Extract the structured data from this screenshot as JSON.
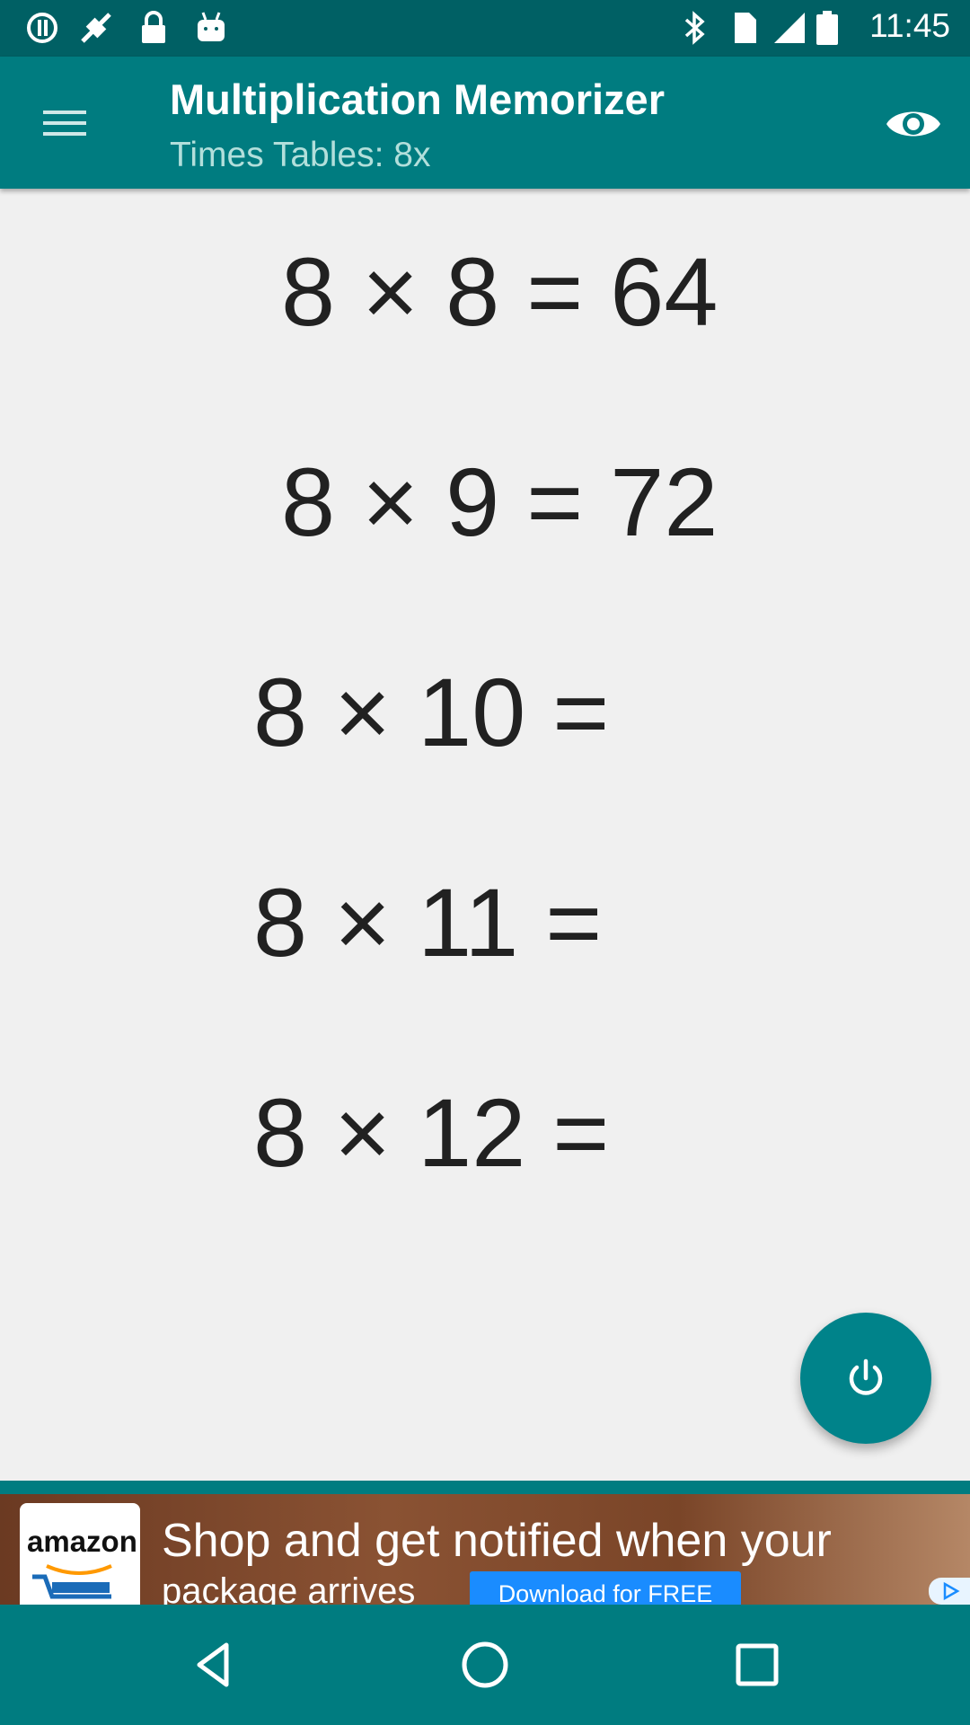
{
  "status_bar": {
    "time": "11:45",
    "icons": [
      "sync-icon",
      "no-signal-icon",
      "lock-icon",
      "android-icon",
      "bluetooth-icon",
      "sim-icon",
      "signal-icon",
      "battery-icon"
    ]
  },
  "app_bar": {
    "title": "Multiplication Memorizer",
    "subtitle": "Times Tables: 8x",
    "menu_icon": "hamburger-menu-icon",
    "action_icon": "eye-icon"
  },
  "equations": [
    {
      "text": "8 × 8 = 64"
    },
    {
      "text": "8 × 9 = 72"
    },
    {
      "text": "8 × 10 ="
    },
    {
      "text": "8 × 11 ="
    },
    {
      "text": "8 × 12 ="
    }
  ],
  "fab": {
    "icon": "power-icon"
  },
  "ad": {
    "logo_text": "amazon",
    "line1": "Shop and get notified when your",
    "line2": "package arrives",
    "button": "Download for FREE"
  },
  "nav": {
    "icons": [
      "back-icon",
      "home-icon",
      "recents-icon"
    ]
  },
  "colors": {
    "primary": "#007c80",
    "primary_dark": "#006064",
    "fab": "#00838a",
    "text": "#212121"
  }
}
